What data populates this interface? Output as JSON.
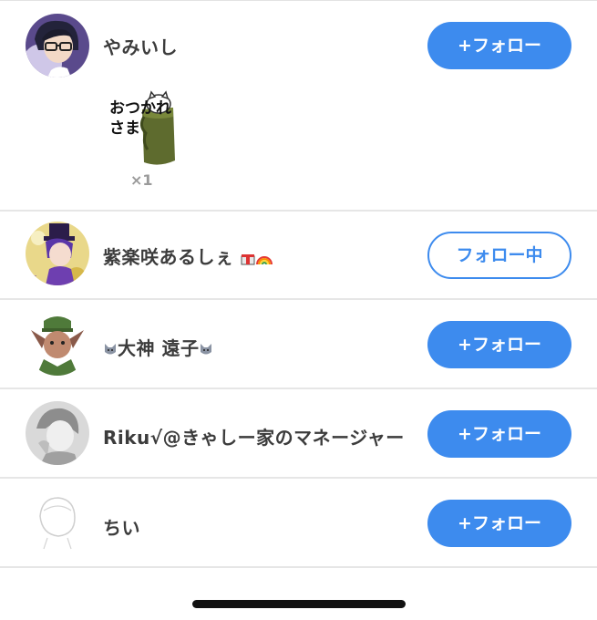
{
  "rows": [
    {
      "name": "やみいし",
      "button": "+フォロー"
    },
    {
      "name": "紫楽咲あるしぇ",
      "button": "フォロー中"
    },
    {
      "name": "大神 遠子",
      "button": "+フォロー"
    },
    {
      "name": "Riku√@きゃしー家のマネージャー",
      "button": "+フォロー"
    },
    {
      "name": "ちい",
      "button": "+フォロー"
    }
  ],
  "sticker": {
    "text": "おつかれさま",
    "count": "×1"
  },
  "colors": {
    "accent": "#3d8bee",
    "divider": "#e6e6e6"
  },
  "icons": [
    "avatar-yamiishi",
    "sticker-otsukaresama",
    "avatar-shigara",
    "wolf-emoji-icon",
    "avatar-riku",
    "avatar-chii",
    "rainbow-emoji-icon",
    "gift-emoji-icon"
  ]
}
